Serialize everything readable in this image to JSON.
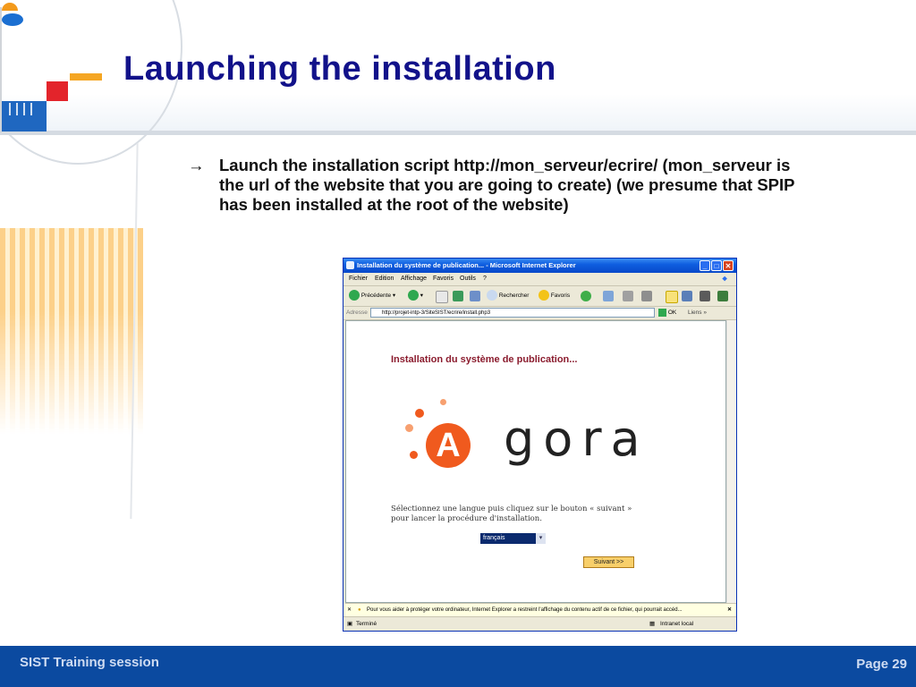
{
  "slide": {
    "title": "Launching the installation",
    "bullet_arrow": "→",
    "bullet_text": "Launch the installation script http://mon_serveur/ecrire/ (mon_serveur is the url of the website that you are going to create) (we presume that SPIP has been installed at the root of the website)"
  },
  "browser": {
    "window_title": "Installation du système de publication... - Microsoft Internet Explorer",
    "menu": [
      "Fichier",
      "Edition",
      "Affichage",
      "Favoris",
      "Outils",
      "?"
    ],
    "toolbar": {
      "back": "Précédente",
      "search": "Rechercher",
      "favorites": "Favoris"
    },
    "address_label": "Adresse",
    "address": "http://projet-intp-3/SiteSIST/ecrire/install.php3",
    "go": "OK",
    "links": "Liens",
    "page": {
      "heading": "Installation du système de publication...",
      "logo_letter": "A",
      "logo_word": "gora",
      "instruction_1": "Sélectionnez une langue puis cliquez sur le bouton « suivant »",
      "instruction_2": "pour lancer la procédure d'installation.",
      "language": "français",
      "next_button": "Suivant >>"
    },
    "info_bar": "Pour vous aider à protéger votre ordinateur, Internet Explorer a restreint l'affichage du contenu actif de ce fichier, qui pourrait accéd...",
    "status_left": "Terminé",
    "status_right": "Intranet local"
  },
  "footer": {
    "left": "SIST Training session",
    "right": "Page 29"
  },
  "colors": {
    "title": "#12128a",
    "footer": "#0b4aa0",
    "accent_orange": "#f05a1e"
  }
}
